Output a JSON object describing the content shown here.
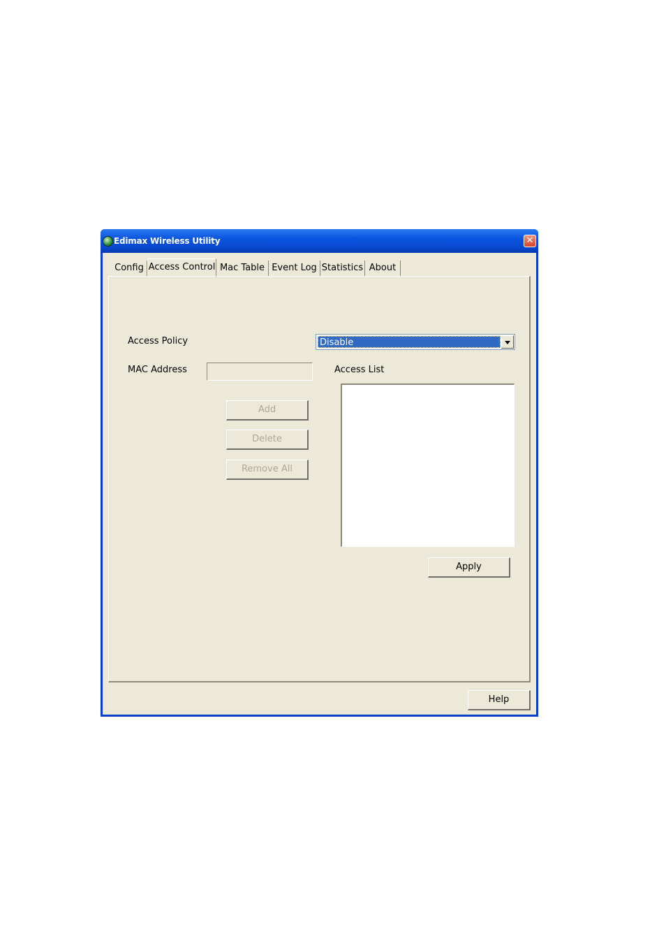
{
  "window": {
    "title": "Edimax Wireless Utility",
    "close_label": "✕"
  },
  "tabs": [
    {
      "label": "Config",
      "active": false
    },
    {
      "label": "Access Control",
      "active": true
    },
    {
      "label": "Mac Table",
      "active": false
    },
    {
      "label": "Event Log",
      "active": false
    },
    {
      "label": "Statistics",
      "active": false
    },
    {
      "label": "About",
      "active": false
    }
  ],
  "access_control": {
    "access_policy_label": "Access Policy",
    "access_policy_value": "Disable",
    "mac_address_label": "MAC Address",
    "mac_address_value": "",
    "access_list_label": "Access List",
    "access_list_items": [],
    "add_label": "Add",
    "delete_label": "Delete",
    "remove_all_label": "Remove All",
    "apply_label": "Apply"
  },
  "footer": {
    "help_label": "Help"
  },
  "colors": {
    "titlebar": "#0a55e0",
    "client_bg": "#ece9d8",
    "selection": "#316ac5"
  }
}
